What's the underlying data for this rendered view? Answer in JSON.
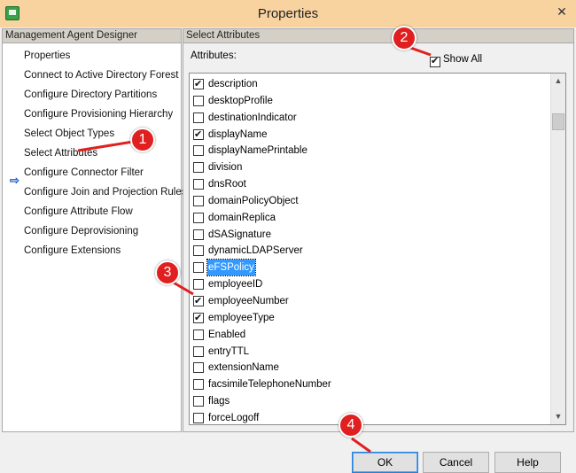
{
  "window": {
    "title": "Properties",
    "close_glyph": "✕"
  },
  "left_pane": {
    "header": "Management Agent Designer",
    "items": [
      "Properties",
      "Connect to Active Directory Forest",
      "Configure Directory Partitions",
      "Configure Provisioning Hierarchy",
      "Select Object Types",
      "Select Attributes",
      "Configure Connector Filter",
      "Configure Join and Projection Rules",
      "Configure Attribute Flow",
      "Configure Deprovisioning",
      "Configure Extensions"
    ],
    "active_item": "Select Attributes",
    "active_glyph": "⇨"
  },
  "right_pane": {
    "header": "Select Attributes",
    "attributes_label": "Attributes:",
    "show_all_label": "Show All",
    "show_all_checked": true,
    "attributes": [
      {
        "name": "description",
        "checked": true,
        "selected": false
      },
      {
        "name": "desktopProfile",
        "checked": false,
        "selected": false
      },
      {
        "name": "destinationIndicator",
        "checked": false,
        "selected": false
      },
      {
        "name": "displayName",
        "checked": true,
        "selected": false
      },
      {
        "name": "displayNamePrintable",
        "checked": false,
        "selected": false
      },
      {
        "name": "division",
        "checked": false,
        "selected": false
      },
      {
        "name": "dnsRoot",
        "checked": false,
        "selected": false
      },
      {
        "name": "domainPolicyObject",
        "checked": false,
        "selected": false
      },
      {
        "name": "domainReplica",
        "checked": false,
        "selected": false
      },
      {
        "name": "dSASignature",
        "checked": false,
        "selected": false
      },
      {
        "name": "dynamicLDAPServer",
        "checked": false,
        "selected": false
      },
      {
        "name": "eFSPolicy",
        "checked": false,
        "selected": true
      },
      {
        "name": "employeeID",
        "checked": false,
        "selected": false
      },
      {
        "name": "employeeNumber",
        "checked": true,
        "selected": false
      },
      {
        "name": "employeeType",
        "checked": true,
        "selected": false
      },
      {
        "name": "Enabled",
        "checked": false,
        "selected": false
      },
      {
        "name": "entryTTL",
        "checked": false,
        "selected": false
      },
      {
        "name": "extensionName",
        "checked": false,
        "selected": false
      },
      {
        "name": "facsimileTelephoneNumber",
        "checked": false,
        "selected": false
      },
      {
        "name": "flags",
        "checked": false,
        "selected": false
      },
      {
        "name": "forceLogoff",
        "checked": false,
        "selected": false
      }
    ],
    "scroll_up_glyph": "▲",
    "scroll_down_glyph": "▼"
  },
  "buttons": {
    "ok": "OK",
    "cancel": "Cancel",
    "help": "Help"
  },
  "callouts": [
    "1",
    "2",
    "3",
    "4"
  ],
  "colors": {
    "callout": "#e02020",
    "selection": "#3399ff",
    "title_bar": "#f8d3a0"
  }
}
